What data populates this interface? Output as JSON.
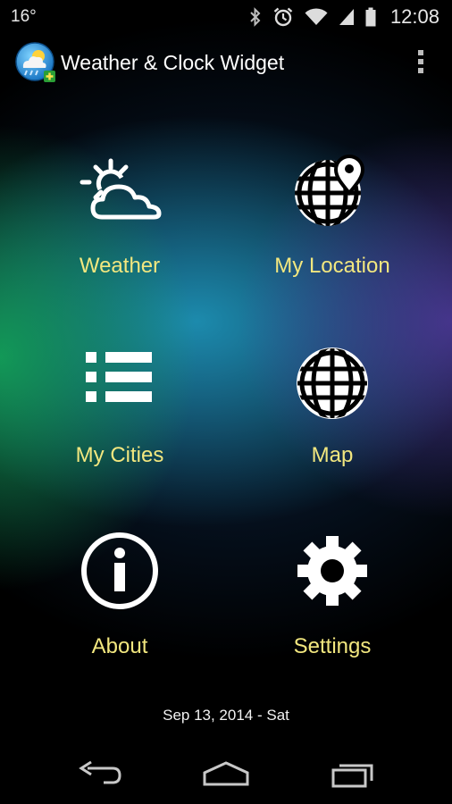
{
  "status_bar": {
    "temperature": "16°",
    "time": "12:08",
    "icons": [
      "bluetooth-icon",
      "alarm-icon",
      "wifi-icon",
      "signal-icon",
      "battery-icon"
    ]
  },
  "app_bar": {
    "title": "Weather & Clock Widget",
    "logo_icon": "weather-app-logo-icon",
    "menu_icon": "overflow-menu-icon"
  },
  "menu": {
    "weather": {
      "label": "Weather",
      "icon": "partly-cloudy-icon"
    },
    "my_location": {
      "label": "My Location",
      "icon": "globe-pin-icon"
    },
    "my_cities": {
      "label": "My Cities",
      "icon": "list-icon"
    },
    "map": {
      "label": "Map",
      "icon": "globe-icon"
    },
    "about": {
      "label": "About",
      "icon": "info-icon"
    },
    "settings": {
      "label": "Settings",
      "icon": "gear-icon"
    }
  },
  "date_text": "Sep 13, 2014 - Sat",
  "nav_bar": {
    "icons": [
      "back-icon",
      "home-icon",
      "recents-icon"
    ]
  },
  "colors": {
    "label_yellow": "#f2e77f",
    "icon_white": "#ffffff",
    "background": "#000000"
  }
}
